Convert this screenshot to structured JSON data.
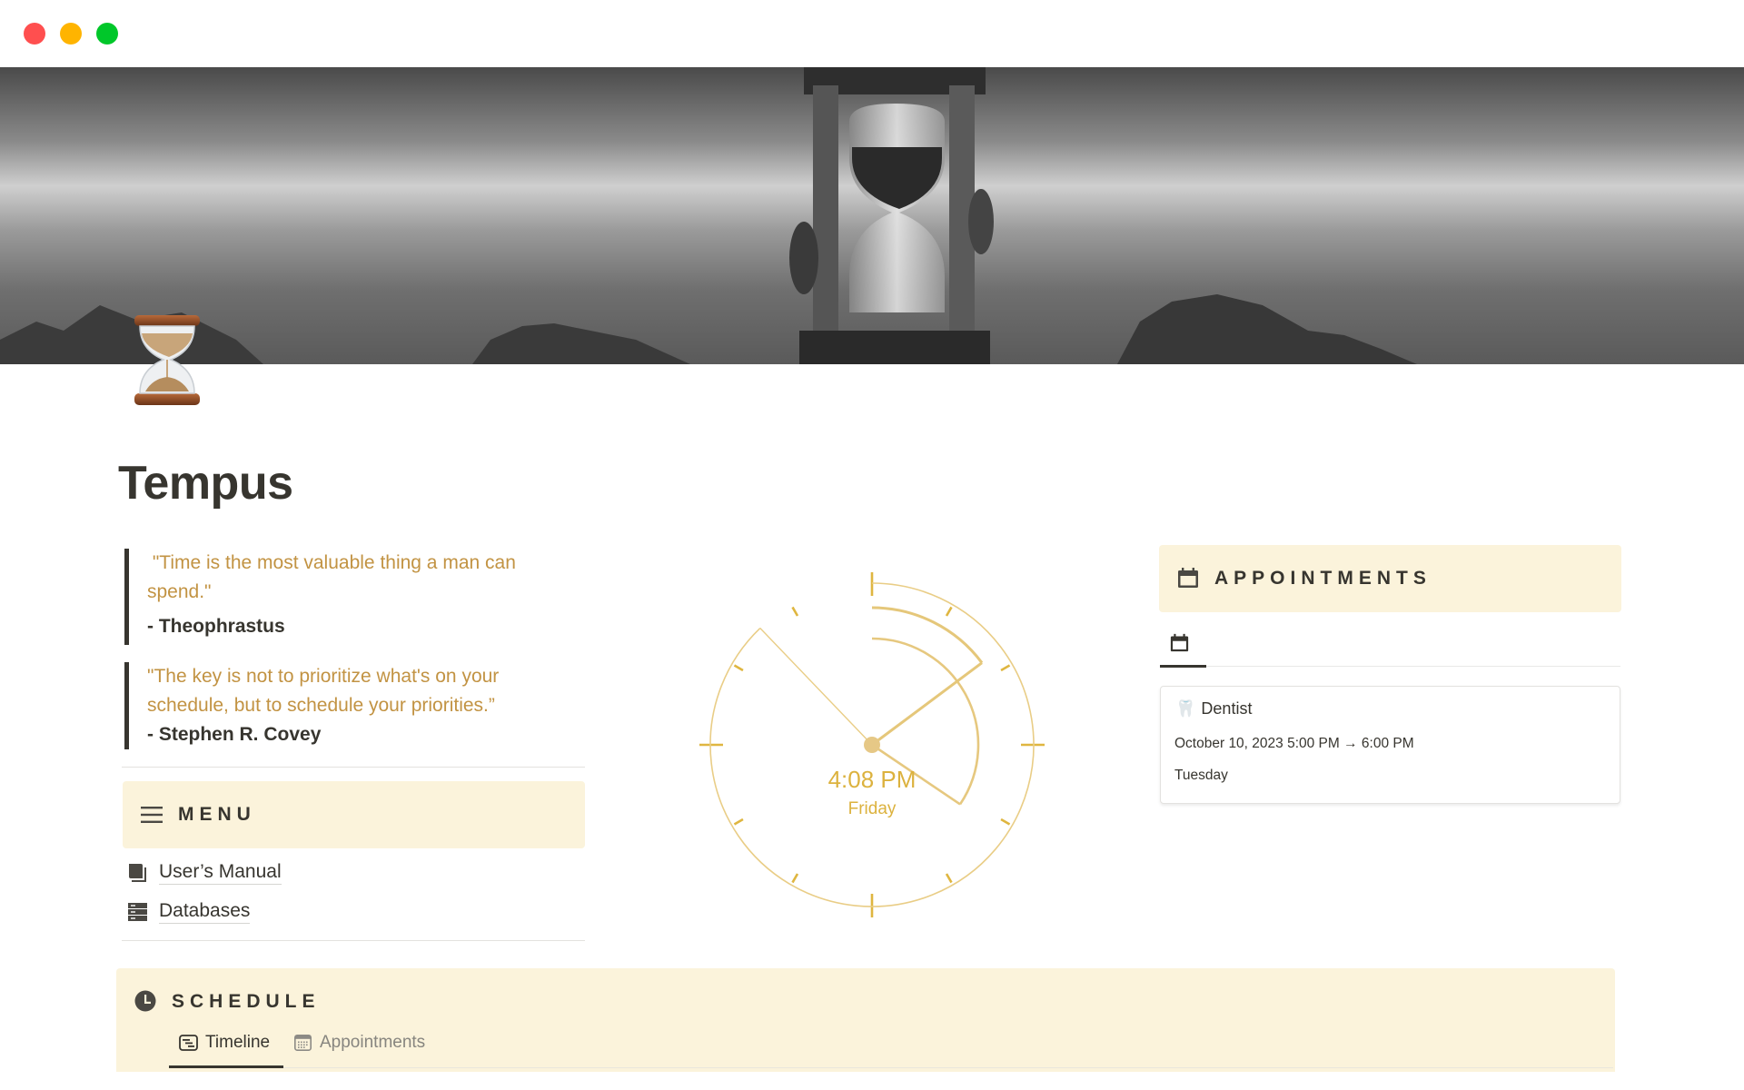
{
  "window": {
    "controls": [
      "close",
      "minimize",
      "zoom"
    ]
  },
  "page": {
    "icon": "hourglass-emoji",
    "title": "Tempus"
  },
  "quotes": [
    {
      "text_lines": [
        " \"Time is the most valuable thing a man can",
        "spend.\""
      ],
      "author": "- Theophrastus"
    },
    {
      "text_lines": [
        "\"The key is not to prioritize what's on your",
        "schedule, but to schedule your priorities.”"
      ],
      "author": "- Stephen R. Covey"
    }
  ],
  "menu": {
    "icon": "hamburger-icon",
    "title": "MENU",
    "links": [
      {
        "icon": "book-icon",
        "label": "User’s Manual"
      },
      {
        "icon": "database-icon",
        "label": "Databases"
      }
    ]
  },
  "clock": {
    "time_label": "4:08 PM",
    "day_label": "Friday",
    "hours": 4,
    "minutes": 8,
    "seconds": 52.7,
    "color": "#e2b94a"
  },
  "appointments": {
    "icon": "calendar-icon",
    "title": "APPOINTMENTS",
    "view_tab_icon": "calendar-icon",
    "cards": [
      {
        "emoji": "🦷",
        "name": "Dentist",
        "date_range": "October 10, 2023 5:00 PM → 6:00 PM",
        "weekday": "Tuesday"
      }
    ]
  },
  "schedule": {
    "icon": "clock-icon",
    "title": "SCHEDULE",
    "tabs": [
      {
        "icon": "timeline-icon",
        "label": "Timeline",
        "active": true
      },
      {
        "icon": "calendar-grid-icon",
        "label": "Appointments",
        "active": false
      }
    ]
  },
  "colors": {
    "callout_bg": "#fbf3db",
    "quote_text": "#c29343",
    "text": "#37352f"
  }
}
